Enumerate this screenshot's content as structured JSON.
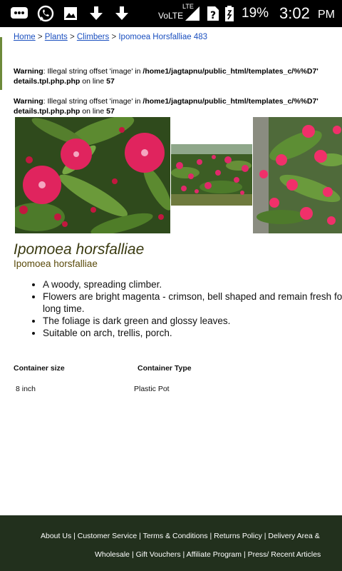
{
  "statusbar": {
    "network": "VoLTE",
    "lte": "LTE",
    "battery": "19%",
    "time": "3:02",
    "ampm": "PM",
    "icons": [
      "message-icon",
      "whatsapp-icon",
      "gallery-icon",
      "download-icon",
      "download-icon",
      "signal-icon",
      "unknown-sim-icon",
      "battery-icon"
    ]
  },
  "breadcrumb": {
    "home": "Home",
    "sep": " > ",
    "plants": "Plants",
    "climbers": "Climbers",
    "current": "Ipomoea Horsfalliae 483"
  },
  "warnings": [
    {
      "label": "Warning",
      "message": ": Illegal string offset 'image' in ",
      "path": "/home1/jagtapnu/public_html/templates_c/%%D7'",
      "path2": "details.tpl.php.php",
      "online": " on line ",
      "line": "57"
    },
    {
      "label": "Warning",
      "message": ": Illegal string offset 'image' in ",
      "path": "/home1/jagtapnu/public_html/templates_c/%%D7'",
      "path2": "details.tpl.php.php",
      "online": " on line ",
      "line": "57"
    }
  ],
  "product": {
    "title": "Ipomoea horsfalliae",
    "subtitle": "Ipomoea horsfalliae",
    "features": [
      "A woody, spreading climber.",
      "Flowers are bright magenta - crimson, bell shaped and remain fresh for a long time.",
      "The foliage is dark green and glossy leaves.",
      "Suitable on arch, trellis, porch."
    ]
  },
  "table": {
    "headers": [
      "Container size",
      "Container Type"
    ],
    "row": [
      "8 inch",
      "Plastic Pot"
    ]
  },
  "footer": {
    "line1": "About Us | Customer Service | Terms & Conditions | Returns Policy | Delivery Area &",
    "line2": "Wholesale | Gift Vouchers | Affiliate Program | Press/ Recent Articles"
  },
  "colors": {
    "link": "#1a4fbf",
    "title": "#3a3a10",
    "footer_bg": "#22301d"
  }
}
